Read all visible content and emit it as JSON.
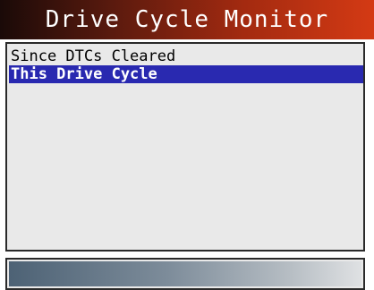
{
  "header": {
    "title": "Drive Cycle Monitor"
  },
  "menu": {
    "items": [
      {
        "label": "Since DTCs Cleared",
        "selected": false
      },
      {
        "label": "This Drive Cycle",
        "selected": true
      }
    ]
  },
  "colors": {
    "selection": "#2929b0",
    "title_bar": "#a32a10"
  }
}
